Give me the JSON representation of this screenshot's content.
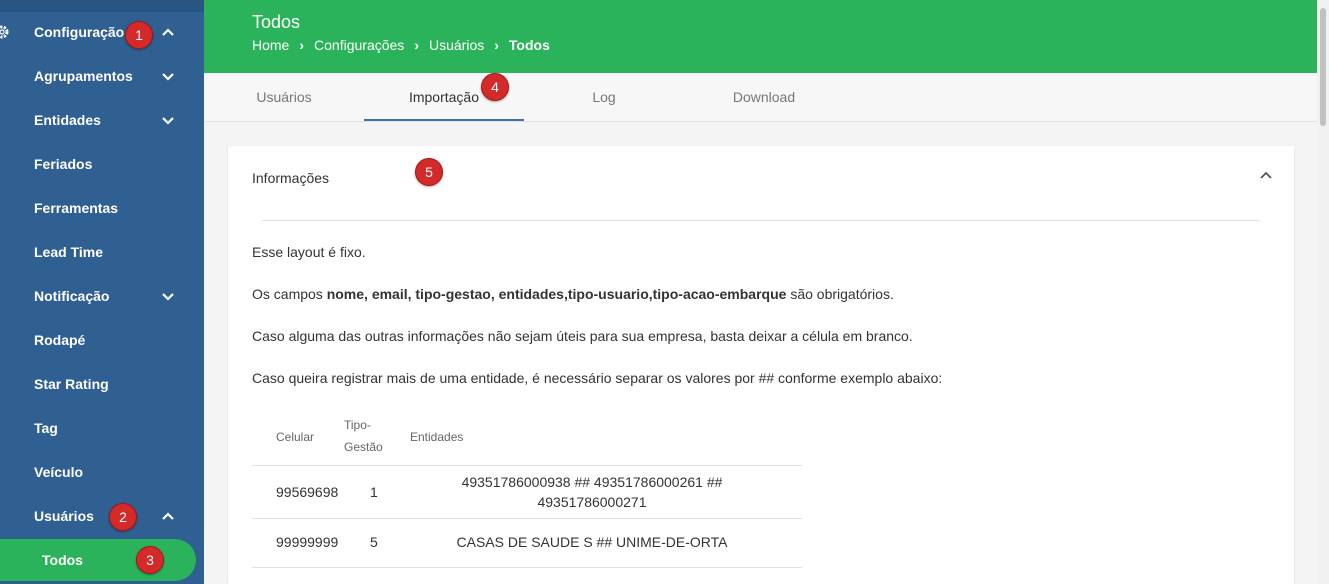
{
  "sidebar": {
    "items": [
      {
        "label": "Configuração",
        "chevron": "up"
      },
      {
        "label": "Agrupamentos",
        "chevron": "down"
      },
      {
        "label": "Entidades",
        "chevron": "down"
      },
      {
        "label": "Feriados",
        "chevron": ""
      },
      {
        "label": "Ferramentas",
        "chevron": ""
      },
      {
        "label": "Lead Time",
        "chevron": ""
      },
      {
        "label": "Notificação",
        "chevron": "down"
      },
      {
        "label": "Rodapé",
        "chevron": ""
      },
      {
        "label": "Star Rating",
        "chevron": ""
      },
      {
        "label": "Tag",
        "chevron": ""
      },
      {
        "label": "Veículo",
        "chevron": ""
      },
      {
        "label": "Usuários",
        "chevron": "up"
      },
      {
        "label": "Todos",
        "chevron": ""
      }
    ]
  },
  "badges": [
    "1",
    "2",
    "3",
    "4",
    "5"
  ],
  "header": {
    "title": "Todos",
    "breadcrumb": [
      "Home",
      "Configurações",
      "Usuários",
      "Todos"
    ]
  },
  "tabs": [
    {
      "label": "Usuários"
    },
    {
      "label": "Importação"
    },
    {
      "label": "Log"
    },
    {
      "label": "Download"
    }
  ],
  "card": {
    "title": "Informações",
    "p1": "Esse layout é fixo.",
    "p2_prefix": "Os campos ",
    "p2_bold": "nome, email, tipo-gestao, entidades,tipo-usuario,tipo-acao-embarque",
    "p2_suffix": " são obrigatórios.",
    "p3": "Caso alguma das outras informações não sejam úteis para sua empresa, basta deixar a célula em branco.",
    "p4": "Caso queira registrar mais de uma entidade, é necessário separar os valores por ## conforme exemplo abaixo:"
  },
  "table": {
    "headers": [
      "Celular",
      "Tipo-",
      "Gestão",
      "Entidades"
    ],
    "rows": [
      {
        "celular": "99569698",
        "tipo": "1",
        "entidades_1": "49351786000938 ## 49351786000261 ##",
        "entidades_2": "49351786000271"
      },
      {
        "celular": "99999999",
        "tipo": "5",
        "entidades_1": "CASAS DE SAUDE S ## UNIME-DE-ORTA",
        "entidades_2": ""
      }
    ]
  },
  "colors": {
    "sidebar": "#305f92",
    "header": "#2bb35b",
    "badge": "#d42a2a",
    "active_tab_underline": "#3b72a8"
  }
}
